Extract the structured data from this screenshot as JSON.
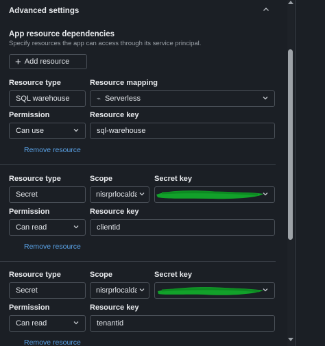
{
  "header": {
    "title": "Advanced settings"
  },
  "section": {
    "title": "App resource dependencies",
    "description": "Specify resources the app can access through its service principal.",
    "add_label": "Add resource"
  },
  "labels": {
    "resource_type": "Resource type",
    "resource_mapping": "Resource mapping",
    "permission": "Permission",
    "resource_key": "Resource key",
    "scope": "Scope",
    "secret_key": "Secret key",
    "remove": "Remove resource"
  },
  "resources": [
    {
      "type": "SQL warehouse",
      "mapping": "Serverless",
      "permission": "Can use",
      "resource_key": "sql-warehouse"
    },
    {
      "type": "Secret",
      "scope": "nisrprlocalda...",
      "permission": "Can read",
      "resource_key": "clientid"
    },
    {
      "type": "Secret",
      "scope": "nisrprlocalda...",
      "permission": "Can read",
      "resource_key": "tenantid"
    }
  ],
  "colors": {
    "background": "#1b1f25",
    "border": "#4a5058",
    "link": "#5aa3e8",
    "redaction": "#12a12a"
  }
}
